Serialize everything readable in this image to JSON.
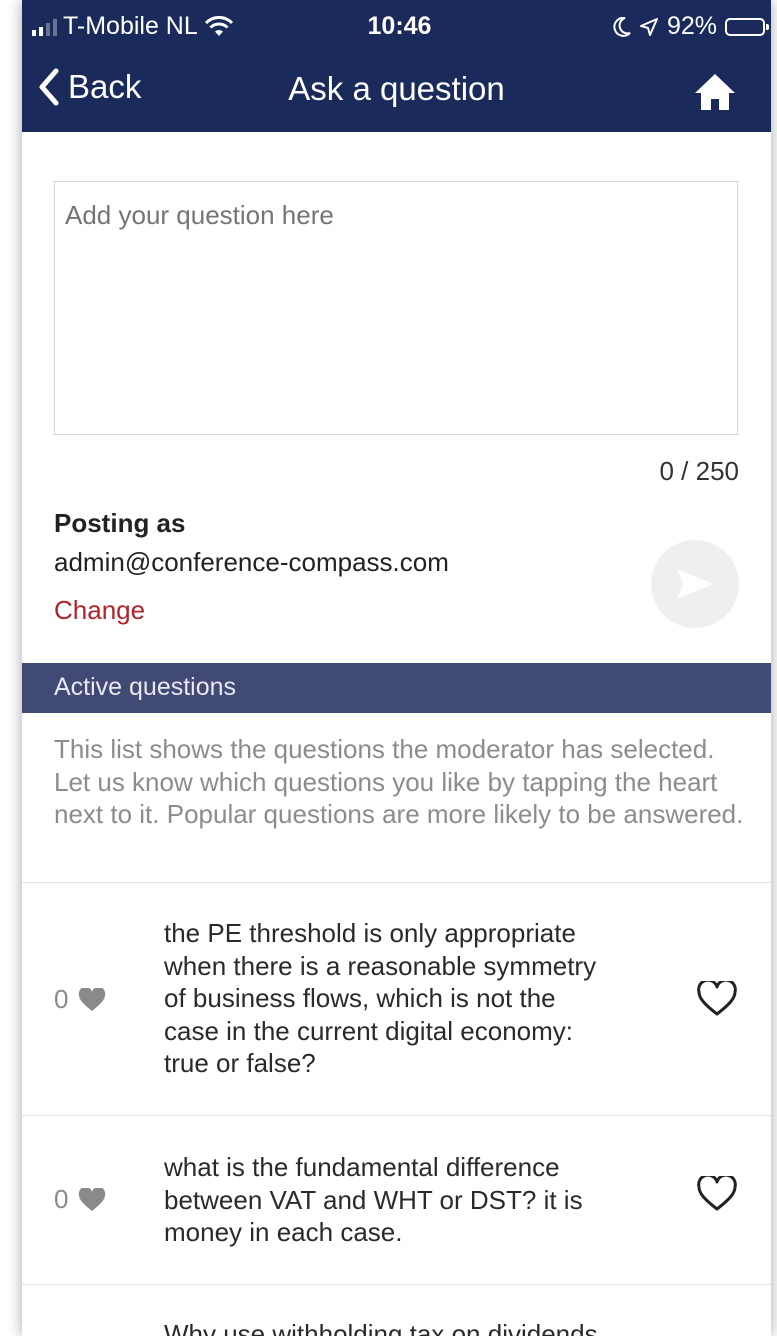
{
  "status_bar": {
    "carrier": "T-Mobile NL",
    "time": "10:46",
    "battery": "92%"
  },
  "nav": {
    "back_label": "Back",
    "title": "Ask a question"
  },
  "form": {
    "placeholder": "Add your question here",
    "counter": "0 / 250",
    "posting_label": "Posting as",
    "email": "admin@conference-compass.com",
    "change_label": "Change"
  },
  "section": {
    "header": "Active questions",
    "intro": "This list shows the questions the moderator has selected. Let us know which questions you like by tapping the heart next to it. Popular questions are more likely to be answered."
  },
  "questions": [
    {
      "likes": "0",
      "lines": [
        "the PE threshold is only appropriate",
        "when there is a reasonable symmetry",
        "of business flows, which is not the",
        "case in the current digital economy:",
        "true or false?"
      ]
    },
    {
      "likes": "0",
      "lines": [
        "what is the fundamental difference",
        "between VAT and WHT or DST? it is",
        "money in each case."
      ]
    },
    {
      "likes": "",
      "lines": [
        "Why use withholding tax on dividends"
      ]
    }
  ],
  "colors": {
    "nav_bg": "#1a2a5b",
    "section_bg": "#404a75",
    "accent_red": "#b3232a"
  }
}
